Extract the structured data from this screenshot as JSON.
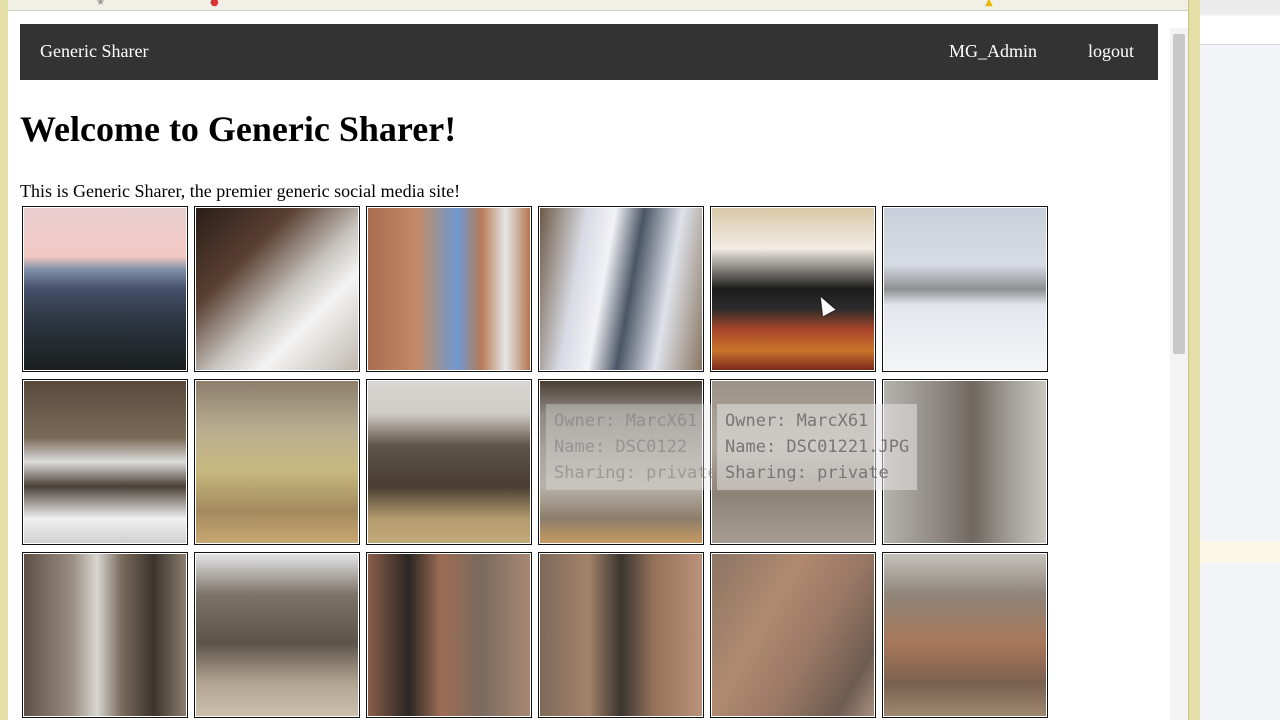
{
  "navbar": {
    "brand": "Generic Sharer",
    "user": "MG_Admin",
    "logout": "logout"
  },
  "page": {
    "title": "Welcome to Generic Sharer!",
    "intro": "This is Generic Sharer, the premier generic social media site!"
  },
  "tooltip_main": {
    "owner": "Owner: MarcX61",
    "name": "Name: DSC01221.JPG",
    "sharing": "Sharing: private"
  },
  "tooltip_ghost": {
    "owner": "Owner: MarcX61",
    "name": "Name: DSC0122",
    "sharing": "Sharing: private"
  },
  "colors": {
    "navbar": "#333333",
    "text": "#000000",
    "tile_border": "#111111"
  }
}
